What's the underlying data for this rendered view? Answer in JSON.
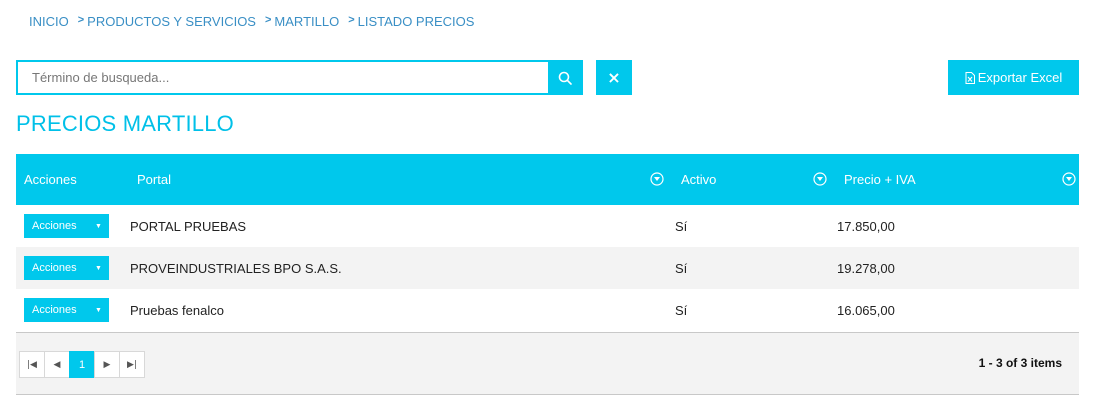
{
  "breadcrumb": [
    {
      "label": "INICIO"
    },
    {
      "sep": ">",
      "label": "PRODUCTOS Y SERVICIOS"
    },
    {
      "sep": ">",
      "label": "MARTILLO"
    },
    {
      "sep": ">",
      "label": "LISTADO PRECIOS"
    }
  ],
  "search": {
    "placeholder": "Término de busqueda...",
    "value": ""
  },
  "toolbar": {
    "clear_icon": "×",
    "export_label": "Exportar Excel"
  },
  "page_title": "PRECIOS MARTILLO",
  "grid": {
    "columns": [
      "Acciones",
      "Portal",
      "Activo",
      "Precio + IVA"
    ],
    "rows": [
      {
        "action": "Acciones",
        "portal": "PORTAL PRUEBAS",
        "activo": "Sí",
        "precio": "17.850,00"
      },
      {
        "action": "Acciones",
        "portal": "PROVEINDUSTRIALES BPO S.A.S.",
        "activo": "Sí",
        "precio": "19.278,00"
      },
      {
        "action": "Acciones",
        "portal": "Pruebas fenalco",
        "activo": "Sí",
        "precio": "16.065,00"
      }
    ]
  },
  "pager": {
    "current_page": "1",
    "info": "1 - 3 of 3 items"
  },
  "icons": {
    "search": "search-icon",
    "clear": "close-icon",
    "export": "excel-file-icon",
    "filter": "filter-icon",
    "dropdown": "caret-down-icon",
    "first": "first-page-icon",
    "prev": "prev-page-icon",
    "next": "next-page-icon",
    "last": "last-page-icon"
  },
  "colors": {
    "accent": "#00c8ec",
    "breadcrumb": "#3a8fc5",
    "title": "#00c0e8",
    "row_alt": "#f3f3f3"
  }
}
